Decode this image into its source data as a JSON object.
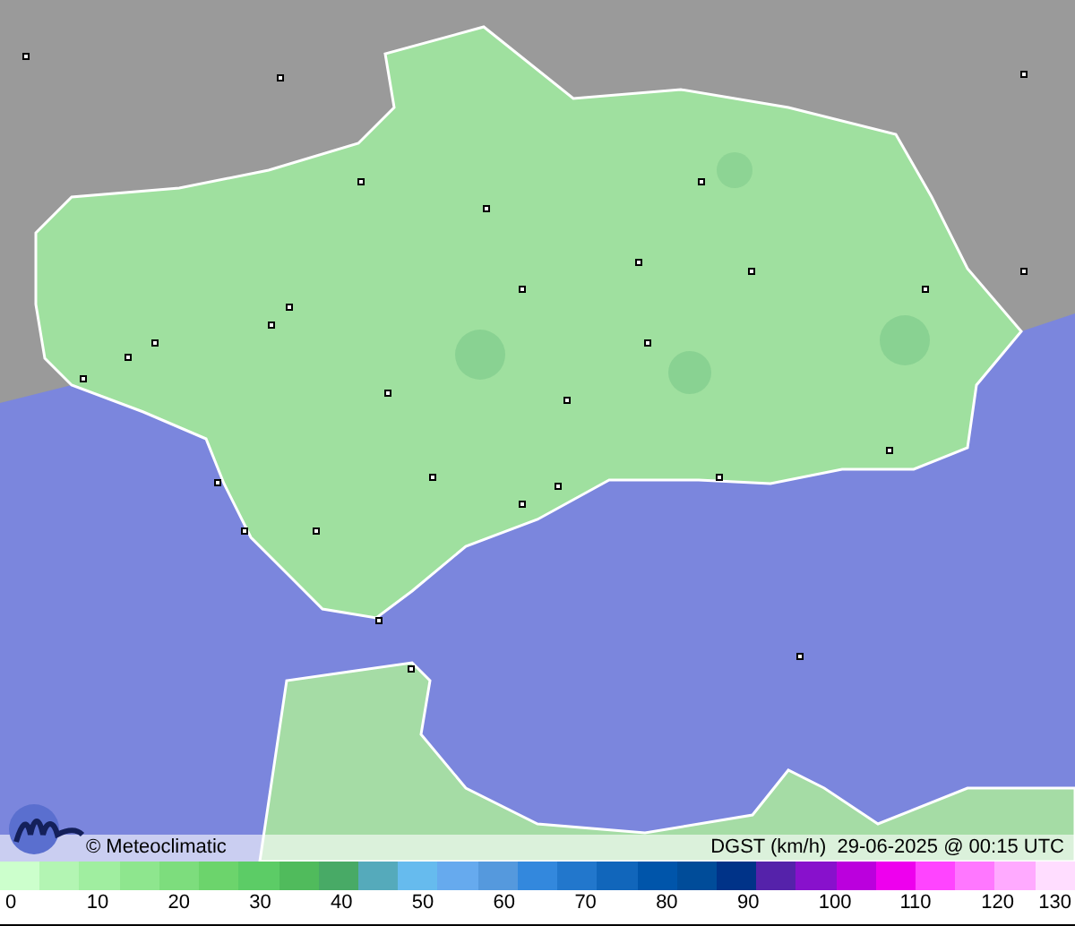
{
  "credit": "© Meteoclimatic",
  "caption": "DGST (km/h)  29-06-2025 @ 00:15 UTC",
  "legend": {
    "swatches": [
      {
        "color": "#ccffcc"
      },
      {
        "color": "#b3f5b3"
      },
      {
        "color": "#a0eea0"
      },
      {
        "color": "#8ee68e"
      },
      {
        "color": "#7ddd7d"
      },
      {
        "color": "#6cd46c"
      },
      {
        "color": "#5ccc66"
      },
      {
        "color": "#50bb5c"
      },
      {
        "color": "#48aa66"
      },
      {
        "color": "#55aabb"
      },
      {
        "color": "#66bbee"
      },
      {
        "color": "#66aaee"
      },
      {
        "color": "#5599dd"
      },
      {
        "color": "#3388dd"
      },
      {
        "color": "#2277cc"
      },
      {
        "color": "#1166bb"
      },
      {
        "color": "#0055aa"
      },
      {
        "color": "#004c99"
      },
      {
        "color": "#003388"
      },
      {
        "color": "#5522aa"
      },
      {
        "color": "#8811cc"
      },
      {
        "color": "#bb00dd"
      },
      {
        "color": "#ee00ee"
      },
      {
        "color": "#ff44ff"
      },
      {
        "color": "#ff77ff"
      },
      {
        "color": "#ffaaff"
      },
      {
        "color": "#ffddff"
      }
    ],
    "labels": [
      "0",
      "10",
      "20",
      "30",
      "40",
      "50",
      "60",
      "70",
      "80",
      "90",
      "100",
      "110",
      "120",
      "130"
    ]
  }
}
